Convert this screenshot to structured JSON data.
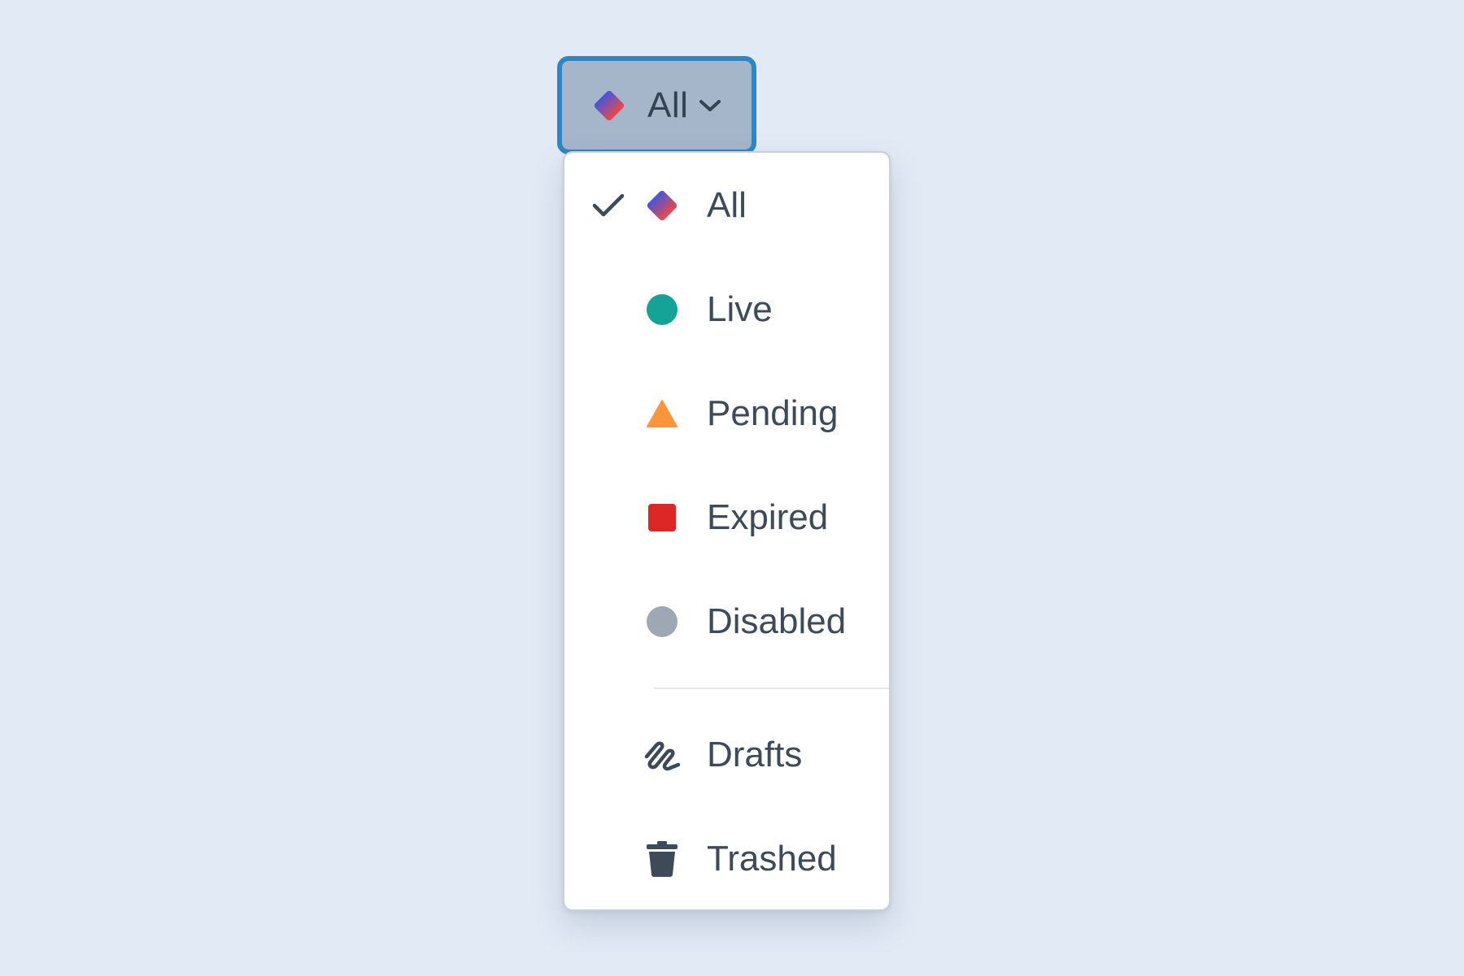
{
  "trigger": {
    "label": "All",
    "icon": "diamond-gradient-icon",
    "chevron_icon": "chevron-down-icon"
  },
  "menu": {
    "items": [
      {
        "label": "All",
        "icon": "diamond-gradient-icon",
        "selected": true
      },
      {
        "label": "Live",
        "icon": "circle-icon",
        "color": "#14a396"
      },
      {
        "label": "Pending",
        "icon": "triangle-icon",
        "color": "#ff943b"
      },
      {
        "label": "Expired",
        "icon": "square-icon",
        "color": "#dd2626"
      },
      {
        "label": "Disabled",
        "icon": "circle-icon",
        "color": "#9ea7b4"
      }
    ],
    "secondary_items": [
      {
        "label": "Drafts",
        "icon": "squiggle-icon"
      },
      {
        "label": "Trashed",
        "icon": "trash-icon"
      }
    ]
  },
  "colors": {
    "background": "#e2eaf5",
    "focus_ring": "#2f86c4",
    "text": "#3d4a5a",
    "diamond_gradient_start": "#3f57e0",
    "diamond_gradient_end": "#ef4747"
  }
}
